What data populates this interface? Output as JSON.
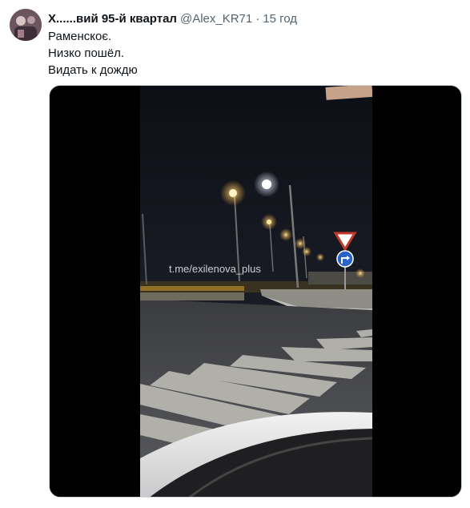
{
  "tweet": {
    "author_name": "Х......вий 95-й квартал",
    "handle": "@Alex_KR71",
    "separator": "·",
    "time": "15 год",
    "text_lines": [
      "Раменскоє.",
      "Низко пошёл.",
      "Видать к дождю"
    ]
  },
  "media": {
    "type": "video",
    "watermark": "t.me/exilenova_plus"
  },
  "colors": {
    "text": "#0f1419",
    "secondary": "#536471",
    "media_bg": "#000000"
  }
}
